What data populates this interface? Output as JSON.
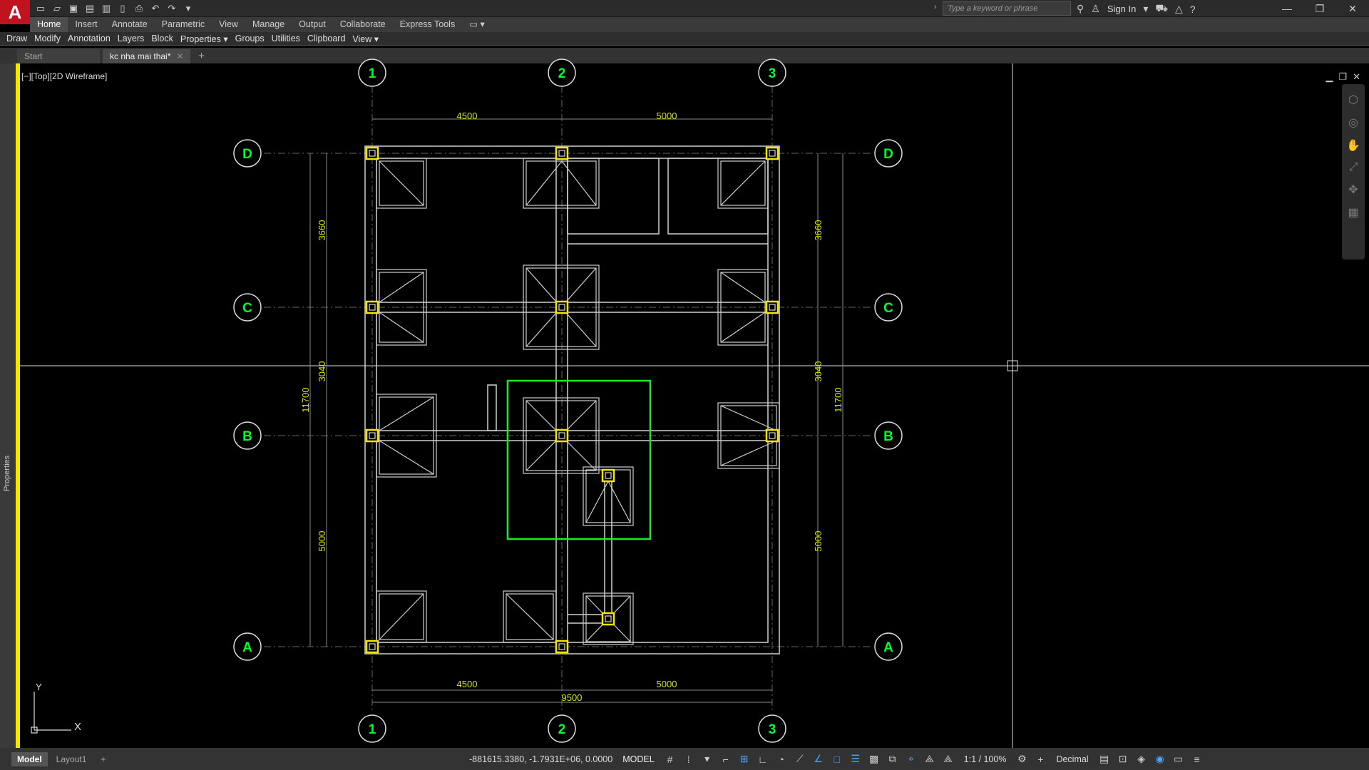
{
  "app": {
    "logo": "A",
    "search_placeholder": "Type a keyword or phrase",
    "sign_in": "Sign In"
  },
  "ribbon": {
    "tabs": [
      "Home",
      "Insert",
      "Annotate",
      "Parametric",
      "View",
      "Manage",
      "Output",
      "Collaborate",
      "Express Tools"
    ],
    "active_tab": "Home",
    "panels": [
      "Draw",
      "Modify",
      "Annotation",
      "Layers",
      "Block",
      "Properties ▾",
      "Groups",
      "Utilities",
      "Clipboard",
      "View ▾"
    ]
  },
  "file_tabs": {
    "start": "Start",
    "active": "kc nha mai thai*"
  },
  "viewport": {
    "label": "[−][Top][2D Wireframe]"
  },
  "palette": {
    "properties_label": "Properties"
  },
  "drawing": {
    "grid_cols": [
      "1",
      "2",
      "3"
    ],
    "grid_rows": [
      "D",
      "C",
      "B",
      "A"
    ],
    "dims_top": [
      "4500",
      "5000"
    ],
    "dims_bottom": [
      "4500",
      "5000"
    ],
    "dim_total_bottom": "9500",
    "dims_left": [
      "3660",
      "3040",
      "5000"
    ],
    "dim_total_left": "11700",
    "dims_right": [
      "3660",
      "3040",
      "5000"
    ],
    "dim_total_right": "11700",
    "ucs_x": "X",
    "ucs_y": "Y"
  },
  "layout_tabs": [
    "Model",
    "Layout1"
  ],
  "status": {
    "coords": "-881615.3380, -1.7931E+06, 0.0000",
    "model": "MODEL",
    "scale": "1:1 / 100%",
    "units": "Decimal"
  },
  "colors": {
    "grid_bubble": "#00ff2a",
    "dim_text": "#d7e600",
    "column_marker": "#f5e600",
    "selection_box": "#1ee81e",
    "accent_bar": "#f5e600"
  }
}
